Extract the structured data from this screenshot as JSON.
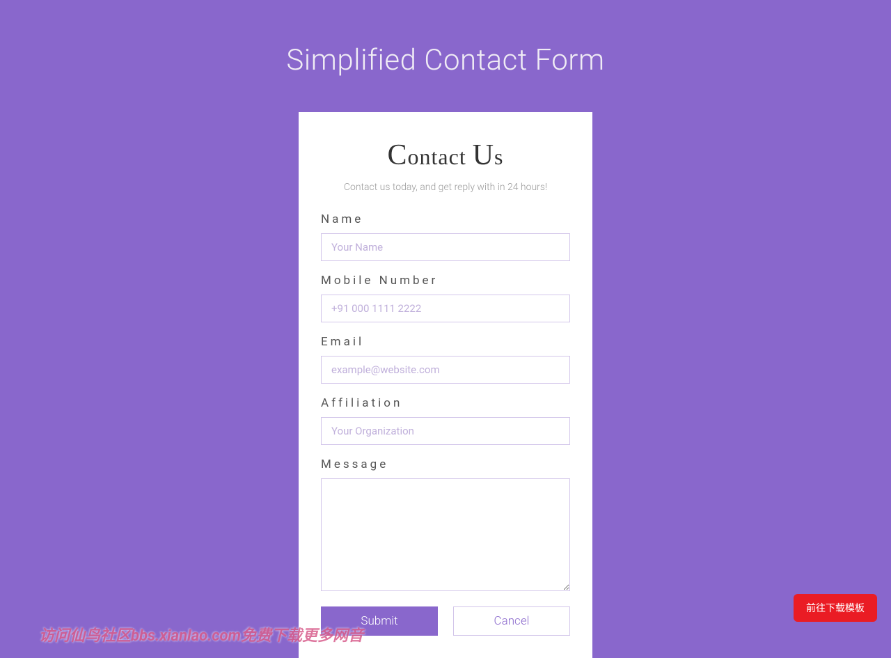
{
  "page": {
    "title": "Simplified Contact Form"
  },
  "card": {
    "title_part1_cap": "C",
    "title_part1_rest": "ontact ",
    "title_part2_cap": "U",
    "title_part2_rest": "s",
    "subtitle": "Contact us today, and get reply with in 24 hours!"
  },
  "form": {
    "name": {
      "label": "Name",
      "placeholder": "Your Name",
      "value": ""
    },
    "mobile": {
      "label": "Mobile Number",
      "placeholder": "+91 000 1111 2222",
      "value": ""
    },
    "email": {
      "label": "Email",
      "placeholder": "example@website.com",
      "value": ""
    },
    "affiliation": {
      "label": "Affiliation",
      "placeholder": "Your Organization",
      "value": ""
    },
    "message": {
      "label": "Message",
      "value": ""
    }
  },
  "buttons": {
    "submit": "Submit",
    "cancel": "Cancel"
  },
  "watermark": "访问仙鸟社区bbs.xianlao.com免费下载更多网音",
  "download_button": "前往下载模板"
}
